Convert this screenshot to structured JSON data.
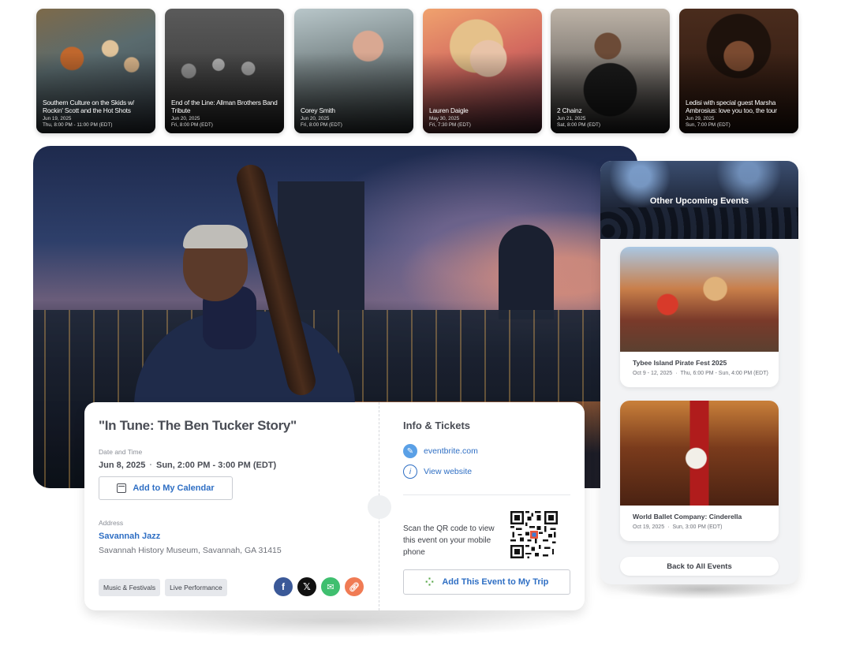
{
  "top_events": [
    {
      "title": "Southern Culture on the Skids w/ Rockin' Scott and the Hot Shots",
      "date": "Jun 19, 2025",
      "time": "Thu, 8:00 PM - 11:00 PM (EDT)"
    },
    {
      "title": "End of the Line: Allman Brothers Band Tribute",
      "date": "Jun 20, 2025",
      "time": "Fri, 8:00 PM (EDT)"
    },
    {
      "title": "Corey Smith",
      "date": "Jun 20, 2025",
      "time": "Fri, 8:00 PM (EDT)"
    },
    {
      "title": "Lauren Daigle",
      "date": "May 30, 2025",
      "time": "Fri, 7:30 PM (EDT)"
    },
    {
      "title": "2 Chainz",
      "date": "Jun 21, 2025",
      "time": "Sat, 8:00 PM (EDT)"
    },
    {
      "title": "Ledisi with special guest Marsha Ambrosius: love you too, the tour",
      "date": "Jun 29, 2025",
      "time": "Sun, 7:00 PM (EDT)"
    }
  ],
  "event": {
    "title": "\"In Tune: The Ben Tucker Story\"",
    "date_label": "Date and Time",
    "date": "Jun 8, 2025",
    "time": "Sun, 2:00 PM - 3:00 PM (EDT)",
    "calendar_button": "Add to My Calendar",
    "address_label": "Address",
    "venue": "Savannah Jazz",
    "address": "Savannah History Museum, Savannah, GA 31415",
    "tags": [
      "Music & Festivals",
      "Live Performance"
    ]
  },
  "info": {
    "heading": "Info & Tickets",
    "ticket_link": "eventbrite.com",
    "website_link": "View website",
    "qr_text": "Scan the QR code to view this event on your mobile phone",
    "trip_button": "Add This Event to My Trip"
  },
  "sidebar": {
    "title": "Other Upcoming Events",
    "events": [
      {
        "title": "Tybee Island Pirate Fest 2025",
        "date": "Oct 9 - 12, 2025",
        "time": "Thu, 6:00 PM - Sun, 4:00 PM (EDT)"
      },
      {
        "title": "World Ballet Company: Cinderella",
        "date": "Oct 19, 2025",
        "time": "Sun, 3:00 PM (EDT)"
      }
    ],
    "back_button": "Back to All Events"
  },
  "icons": {
    "social": [
      "facebook-icon",
      "x-icon",
      "email-icon",
      "link-icon"
    ]
  },
  "colors": {
    "link_blue": "#2f6fc4",
    "facebook": "#3b5998",
    "email": "#3fbf6f",
    "copy_link": "#f07b54"
  }
}
